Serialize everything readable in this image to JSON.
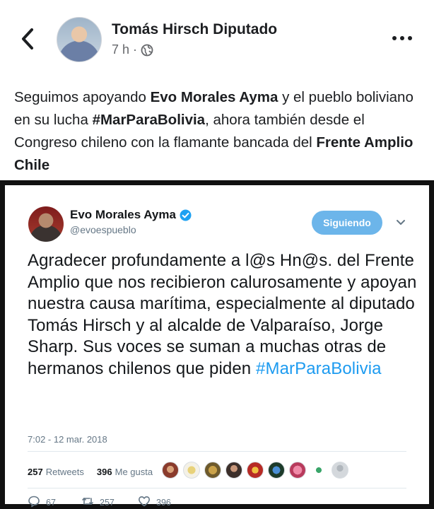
{
  "post": {
    "author": "Tomás Hirsch Diputado",
    "time": "7 h",
    "separator": "·",
    "text_parts": [
      {
        "text": "Seguimos apoyando ",
        "bold": false
      },
      {
        "text": "Evo Morales Ayma",
        "bold": true
      },
      {
        "text": " y el pueblo boliviano en su lucha ",
        "bold": false
      },
      {
        "text": "#MarParaBolivia",
        "bold": true
      },
      {
        "text": ", ahora también desde el Congreso chileno con la flamante bancada del ",
        "bold": false
      },
      {
        "text": "Frente Amplio Chile",
        "bold": true
      }
    ]
  },
  "tweet": {
    "name": "Evo Morales Ayma",
    "handle": "@evoespueblo",
    "follow_label": "Siguiendo",
    "body": "Agradecer profundamente a l@s Hn@s. del Frente Amplio que nos recibieron calurosamente y apoyan nuestra causa marítima, especialmente al diputado Tomás Hirsch y al alcalde de Valparaíso, Jorge Sharp. Sus voces se suman a muchas otras de hermanos chilenos que piden",
    "hashtag": "#MarParaBolivia",
    "timestamp": "7:02 - 12 mar. 2018",
    "retweets_count": "257",
    "retweets_label": "Retweets",
    "likes_count": "396",
    "likes_label": "Me gusta",
    "actions": {
      "replies": "67",
      "retweets": "257",
      "likes": "396"
    }
  },
  "colors": {
    "follow_button": "#6cb5ea",
    "hashtag": "#1d9bf0",
    "verified": "#1da1f2"
  },
  "icons": [
    "back-arrow-icon",
    "globe-icon",
    "more-options-icon",
    "verified-icon",
    "chevron-down-icon",
    "reply-icon",
    "retweet-icon",
    "heart-icon"
  ]
}
